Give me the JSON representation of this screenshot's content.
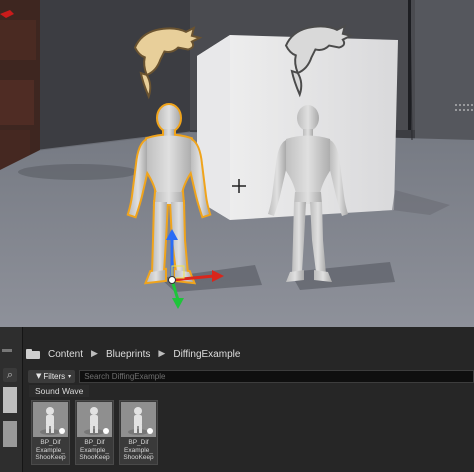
{
  "breadcrumb": {
    "items": [
      "Content",
      "Blueprints",
      "DiffingExample"
    ],
    "separator": "▶"
  },
  "filters": {
    "label": "Filters",
    "search_placeholder": "Search DiffingExample",
    "active_filter": "Sound Wave"
  },
  "assets": [
    {
      "name_line1": "BP_Dif",
      "name_line2": "Example_",
      "name_line3": "ShooKeep",
      "icon": "skeletal-mesh-thumbnail"
    },
    {
      "name_line1": "BP_Dif",
      "name_line2": "Example_",
      "name_line3": "ShooKeep",
      "icon": "skeletal-mesh-thumbnail"
    },
    {
      "name_line1": "BP_Dif",
      "name_line2": "Example_",
      "name_line3": "ShooKeep",
      "icon": "skeletal-mesh-thumbnail"
    }
  ],
  "viewport": {
    "selected_highlight_color": "#f0a41c",
    "gizmo_colors": {
      "x": "#d9261c",
      "y": "#1ec53a",
      "z": "#2a6cf5"
    }
  },
  "colors": {
    "panel_bg": "#262626",
    "floor": "#8a8d95",
    "mannequin": "#c9c9c9"
  }
}
